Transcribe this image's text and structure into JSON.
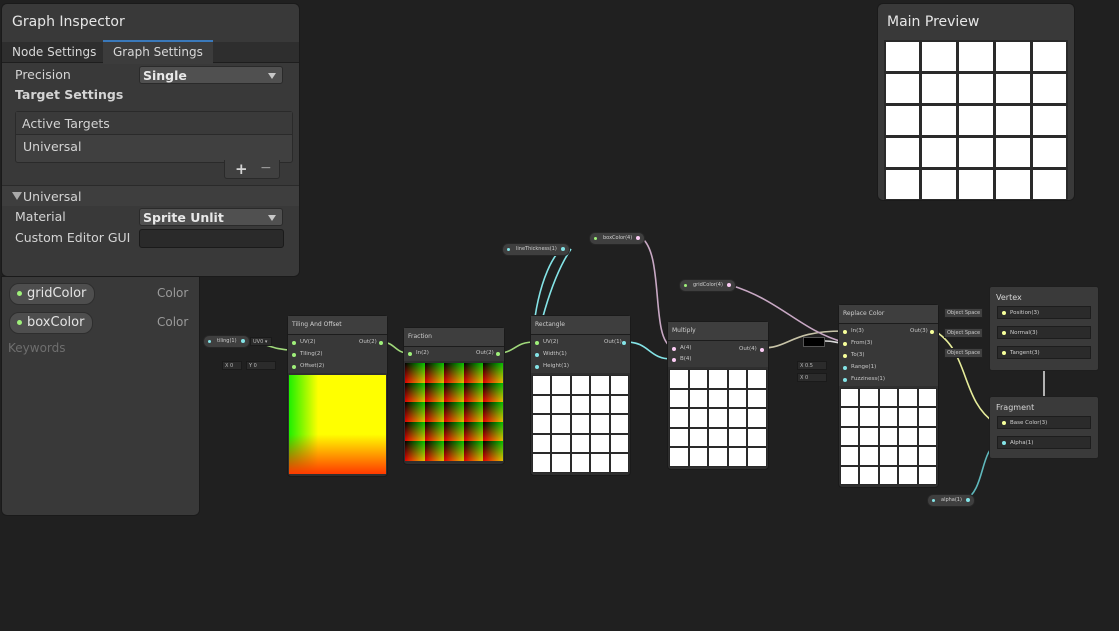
{
  "inspector": {
    "title": "Graph Inspector",
    "tabs": [
      {
        "label": "Node Settings"
      },
      {
        "label": "Graph Settings"
      }
    ],
    "precision_label": "Precision",
    "precision_value": "Single",
    "target_settings_label": "Target Settings",
    "active_targets_label": "Active Targets",
    "target_item": "Universal",
    "add_label": "+",
    "remove_label": "−",
    "universal_section": "Universal",
    "material_label": "Material",
    "material_value": "Sprite Unlit",
    "custom_editor_label": "Custom Editor GUI",
    "custom_editor_value": ""
  },
  "blackboard": {
    "properties": [
      {
        "name": "gridColor",
        "type": "Color"
      },
      {
        "name": "boxColor",
        "type": "Color"
      }
    ],
    "keywords_label": "Keywords"
  },
  "main_preview": {
    "title": "Main Preview"
  },
  "nodes": {
    "tiling_prop": "tiling(1)",
    "uv_dropdown": "UV0",
    "offset_x_label": "X",
    "offset_x": "0",
    "offset_y_label": "Y",
    "offset_y": "0",
    "tiling_offset": {
      "title": "Tiling And Offset",
      "in": [
        "UV(2)",
        "Tiling(2)",
        "Offset(2)"
      ],
      "out": "Out(2)"
    },
    "fraction": {
      "title": "Fraction",
      "in": [
        "In(2)"
      ],
      "out": "Out(2)"
    },
    "line_thickness_prop": "lineThickness(1)",
    "box_color_prop": "boxColor(4)",
    "grid_color_prop": "gridColor(4)",
    "rectangle": {
      "title": "Rectangle",
      "in": [
        "UV(2)",
        "Width(1)",
        "Height(1)"
      ],
      "out": "Out(1)"
    },
    "multiply": {
      "title": "Multiply",
      "in": [
        "A(4)",
        "B(4)"
      ],
      "out": "Out(4)"
    },
    "replace_color": {
      "title": "Replace Color",
      "in": [
        "In(3)",
        "From(3)",
        "To(3)",
        "Range(1)",
        "Fuzziness(1)"
      ],
      "out": "Out(3)"
    },
    "range_x_label": "X",
    "range_value": "0.5",
    "fuzz_x_label": "X",
    "fuzz_value": "0",
    "object_space": [
      "Object Space",
      "Object Space",
      "Object Space"
    ],
    "vertex": {
      "title": "Vertex",
      "ports": [
        "Position(3)",
        "Normal(3)",
        "Tangent(3)"
      ]
    },
    "fragment": {
      "title": "Fragment",
      "ports": [
        "Base Color(3)",
        "Alpha(1)"
      ]
    },
    "alpha_prop": "alpha(1)"
  },
  "colors": {
    "vector2": "#9ff07a",
    "vector1": "#84e4e7",
    "vector4": "#fbcbf4",
    "vector3": "#f6ff9a",
    "accent_tab": "#3a79bb"
  }
}
